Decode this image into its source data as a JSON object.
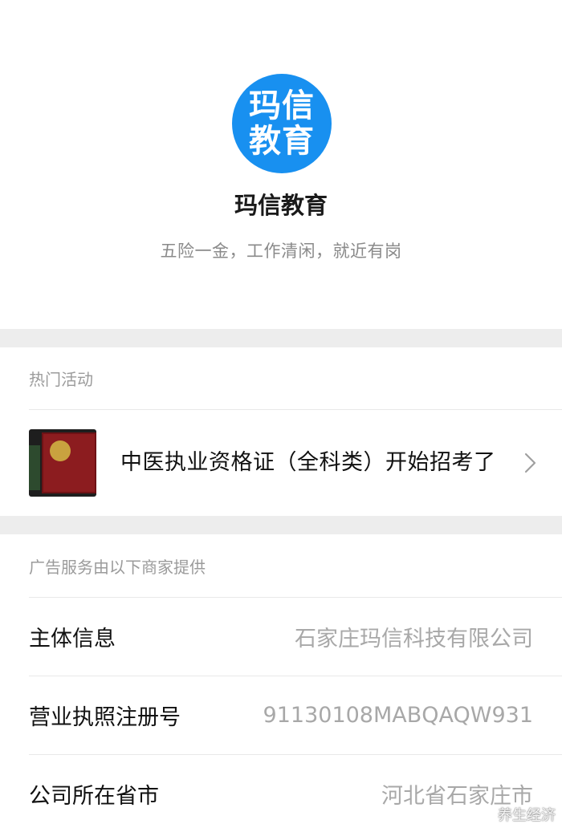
{
  "profile": {
    "avatar_line1": "玛信",
    "avatar_line2": "教育",
    "avatar_color": "#1890f0",
    "name": "玛信教育",
    "slogan": "五险一金，工作清闲，就近有岗"
  },
  "hot_activities": {
    "header": "热门活动",
    "items": [
      {
        "title": "中医执业资格证（全科类）开始招考了",
        "thumb_icon": "certificate-image"
      }
    ]
  },
  "ad_info": {
    "header": "广告服务由以下商家提供",
    "rows": [
      {
        "label": "主体信息",
        "value": "石家庄玛信科技有限公司"
      },
      {
        "label": "营业执照注册号",
        "value": "91130108MABQAQW931"
      },
      {
        "label": "公司所在省市",
        "value": "河北省石家庄市"
      }
    ]
  },
  "watermark": "养生经济"
}
